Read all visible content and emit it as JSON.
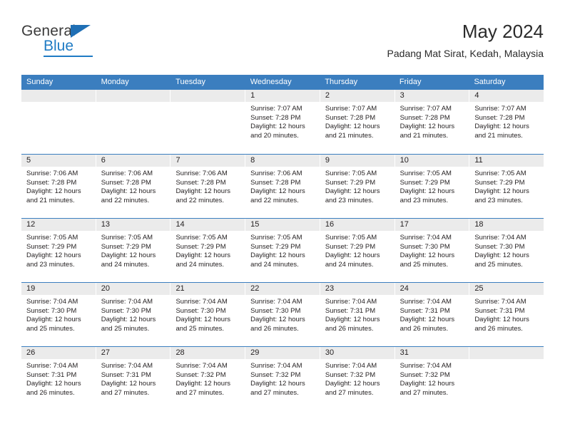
{
  "logo": {
    "word1": "General",
    "word2": "Blue",
    "triangle_color": "#1f6fb5",
    "blue_color": "#1f7bc4"
  },
  "header": {
    "title": "May 2024",
    "subtitle": "Padang Mat Sirat, Kedah, Malaysia"
  },
  "theme": {
    "header_blue": "#3b7ebf",
    "daynum_bg": "#ebebeb",
    "text": "#231f20"
  },
  "weekdays": [
    "Sunday",
    "Monday",
    "Tuesday",
    "Wednesday",
    "Thursday",
    "Friday",
    "Saturday"
  ],
  "weeks": [
    [
      {
        "day": "",
        "lines": []
      },
      {
        "day": "",
        "lines": []
      },
      {
        "day": "",
        "lines": []
      },
      {
        "day": "1",
        "lines": [
          "Sunrise: 7:07 AM",
          "Sunset: 7:28 PM",
          "Daylight: 12 hours",
          "and 20 minutes."
        ]
      },
      {
        "day": "2",
        "lines": [
          "Sunrise: 7:07 AM",
          "Sunset: 7:28 PM",
          "Daylight: 12 hours",
          "and 21 minutes."
        ]
      },
      {
        "day": "3",
        "lines": [
          "Sunrise: 7:07 AM",
          "Sunset: 7:28 PM",
          "Daylight: 12 hours",
          "and 21 minutes."
        ]
      },
      {
        "day": "4",
        "lines": [
          "Sunrise: 7:07 AM",
          "Sunset: 7:28 PM",
          "Daylight: 12 hours",
          "and 21 minutes."
        ]
      }
    ],
    [
      {
        "day": "5",
        "lines": [
          "Sunrise: 7:06 AM",
          "Sunset: 7:28 PM",
          "Daylight: 12 hours",
          "and 21 minutes."
        ]
      },
      {
        "day": "6",
        "lines": [
          "Sunrise: 7:06 AM",
          "Sunset: 7:28 PM",
          "Daylight: 12 hours",
          "and 22 minutes."
        ]
      },
      {
        "day": "7",
        "lines": [
          "Sunrise: 7:06 AM",
          "Sunset: 7:28 PM",
          "Daylight: 12 hours",
          "and 22 minutes."
        ]
      },
      {
        "day": "8",
        "lines": [
          "Sunrise: 7:06 AM",
          "Sunset: 7:28 PM",
          "Daylight: 12 hours",
          "and 22 minutes."
        ]
      },
      {
        "day": "9",
        "lines": [
          "Sunrise: 7:05 AM",
          "Sunset: 7:29 PM",
          "Daylight: 12 hours",
          "and 23 minutes."
        ]
      },
      {
        "day": "10",
        "lines": [
          "Sunrise: 7:05 AM",
          "Sunset: 7:29 PM",
          "Daylight: 12 hours",
          "and 23 minutes."
        ]
      },
      {
        "day": "11",
        "lines": [
          "Sunrise: 7:05 AM",
          "Sunset: 7:29 PM",
          "Daylight: 12 hours",
          "and 23 minutes."
        ]
      }
    ],
    [
      {
        "day": "12",
        "lines": [
          "Sunrise: 7:05 AM",
          "Sunset: 7:29 PM",
          "Daylight: 12 hours",
          "and 23 minutes."
        ]
      },
      {
        "day": "13",
        "lines": [
          "Sunrise: 7:05 AM",
          "Sunset: 7:29 PM",
          "Daylight: 12 hours",
          "and 24 minutes."
        ]
      },
      {
        "day": "14",
        "lines": [
          "Sunrise: 7:05 AM",
          "Sunset: 7:29 PM",
          "Daylight: 12 hours",
          "and 24 minutes."
        ]
      },
      {
        "day": "15",
        "lines": [
          "Sunrise: 7:05 AM",
          "Sunset: 7:29 PM",
          "Daylight: 12 hours",
          "and 24 minutes."
        ]
      },
      {
        "day": "16",
        "lines": [
          "Sunrise: 7:05 AM",
          "Sunset: 7:29 PM",
          "Daylight: 12 hours",
          "and 24 minutes."
        ]
      },
      {
        "day": "17",
        "lines": [
          "Sunrise: 7:04 AM",
          "Sunset: 7:30 PM",
          "Daylight: 12 hours",
          "and 25 minutes."
        ]
      },
      {
        "day": "18",
        "lines": [
          "Sunrise: 7:04 AM",
          "Sunset: 7:30 PM",
          "Daylight: 12 hours",
          "and 25 minutes."
        ]
      }
    ],
    [
      {
        "day": "19",
        "lines": [
          "Sunrise: 7:04 AM",
          "Sunset: 7:30 PM",
          "Daylight: 12 hours",
          "and 25 minutes."
        ]
      },
      {
        "day": "20",
        "lines": [
          "Sunrise: 7:04 AM",
          "Sunset: 7:30 PM",
          "Daylight: 12 hours",
          "and 25 minutes."
        ]
      },
      {
        "day": "21",
        "lines": [
          "Sunrise: 7:04 AM",
          "Sunset: 7:30 PM",
          "Daylight: 12 hours",
          "and 25 minutes."
        ]
      },
      {
        "day": "22",
        "lines": [
          "Sunrise: 7:04 AM",
          "Sunset: 7:30 PM",
          "Daylight: 12 hours",
          "and 26 minutes."
        ]
      },
      {
        "day": "23",
        "lines": [
          "Sunrise: 7:04 AM",
          "Sunset: 7:31 PM",
          "Daylight: 12 hours",
          "and 26 minutes."
        ]
      },
      {
        "day": "24",
        "lines": [
          "Sunrise: 7:04 AM",
          "Sunset: 7:31 PM",
          "Daylight: 12 hours",
          "and 26 minutes."
        ]
      },
      {
        "day": "25",
        "lines": [
          "Sunrise: 7:04 AM",
          "Sunset: 7:31 PM",
          "Daylight: 12 hours",
          "and 26 minutes."
        ]
      }
    ],
    [
      {
        "day": "26",
        "lines": [
          "Sunrise: 7:04 AM",
          "Sunset: 7:31 PM",
          "Daylight: 12 hours",
          "and 26 minutes."
        ]
      },
      {
        "day": "27",
        "lines": [
          "Sunrise: 7:04 AM",
          "Sunset: 7:31 PM",
          "Daylight: 12 hours",
          "and 27 minutes."
        ]
      },
      {
        "day": "28",
        "lines": [
          "Sunrise: 7:04 AM",
          "Sunset: 7:32 PM",
          "Daylight: 12 hours",
          "and 27 minutes."
        ]
      },
      {
        "day": "29",
        "lines": [
          "Sunrise: 7:04 AM",
          "Sunset: 7:32 PM",
          "Daylight: 12 hours",
          "and 27 minutes."
        ]
      },
      {
        "day": "30",
        "lines": [
          "Sunrise: 7:04 AM",
          "Sunset: 7:32 PM",
          "Daylight: 12 hours",
          "and 27 minutes."
        ]
      },
      {
        "day": "31",
        "lines": [
          "Sunrise: 7:04 AM",
          "Sunset: 7:32 PM",
          "Daylight: 12 hours",
          "and 27 minutes."
        ]
      },
      {
        "day": "",
        "lines": []
      }
    ]
  ]
}
